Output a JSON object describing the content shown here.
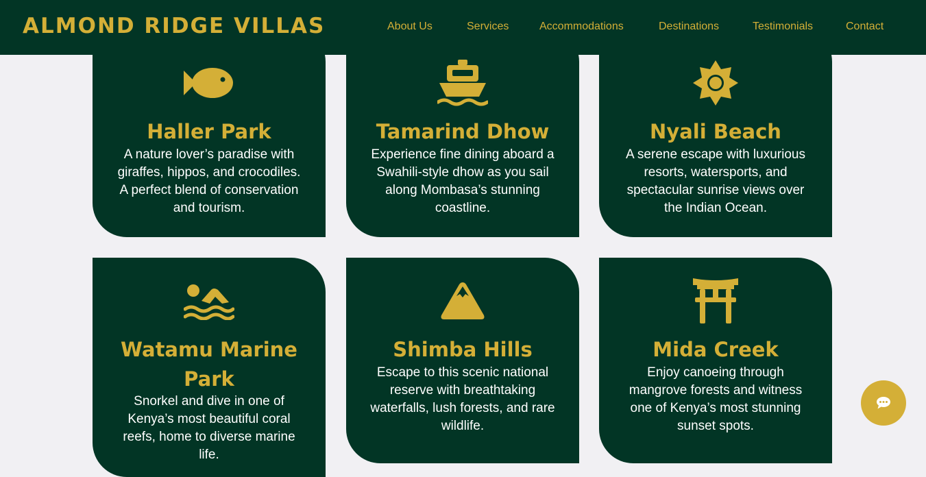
{
  "brand": {
    "name": "ALMOND RIDGE VILLAS"
  },
  "nav": {
    "items": [
      "About Us",
      "Services",
      "Accommodations",
      "Destinations",
      "Testimonials",
      "Contact"
    ]
  },
  "destinations": [
    {
      "icon": "fish-icon",
      "title": "Haller Park",
      "text": "A nature lover’s paradise with giraffes, hippos, and crocodiles. A perfect blend of conservation and tourism."
    },
    {
      "icon": "ship-icon",
      "title": "Tamarind Dhow",
      "text": "Experience fine dining aboard a Swahili-style dhow as you sail along Mombasa’s stunning coastline."
    },
    {
      "icon": "sun-icon",
      "title": "Nyali Beach",
      "text": "A serene escape with luxurious resorts, watersports, and spectacular sunrise views over the Indian Ocean."
    },
    {
      "icon": "swimmer-icon",
      "title": "Watamu Marine Park",
      "text": "Snorkel and dive in one of Kenya’s most beautiful coral reefs, home to diverse marine life."
    },
    {
      "icon": "mountain-icon",
      "title": "Shimba Hills",
      "text": "Escape to this scenic national reserve with breathtaking waterfalls, lush forests, and rare wildlife."
    },
    {
      "icon": "torii-gate-icon",
      "title": "Mida Creek",
      "text": "Enjoy canoeing through mangrove forests and witness one of Kenya’s most stunning sunset spots."
    }
  ],
  "chat": {
    "icon": "chat-icon"
  },
  "colors": {
    "primary": "#023525",
    "accent": "#d4af37",
    "background": "#f1f0f3",
    "text": "#ffffff"
  }
}
